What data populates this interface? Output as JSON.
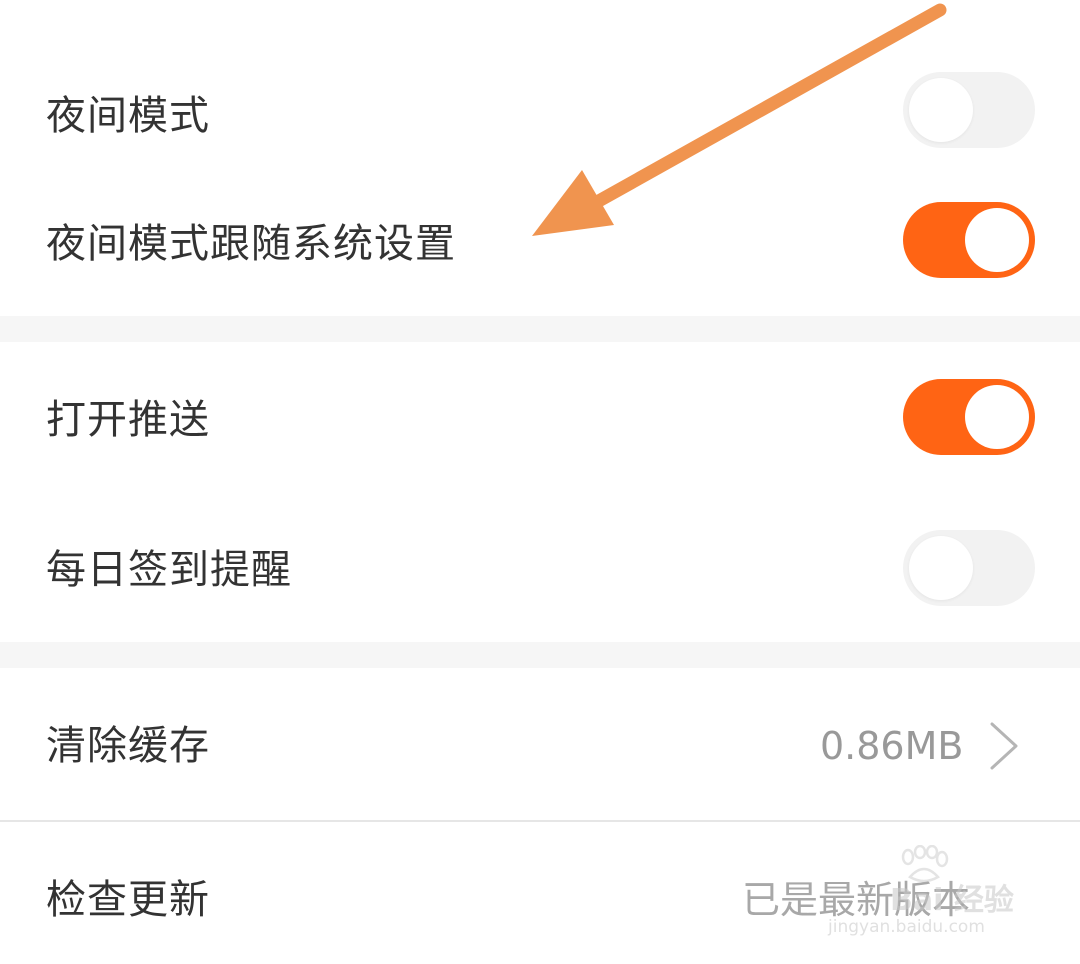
{
  "settings": {
    "night_mode": {
      "label": "夜间模式",
      "enabled": false
    },
    "night_mode_follow_system": {
      "label": "夜间模式跟随系统设置",
      "enabled": true
    },
    "push": {
      "label": "打开推送",
      "enabled": true
    },
    "checkin_reminder": {
      "label": "每日签到提醒",
      "enabled": false
    },
    "clear_cache": {
      "label": "清除缓存",
      "value": "0.86MB"
    },
    "check_update": {
      "label": "检查更新",
      "value": "已是最新版本"
    }
  },
  "watermark": {
    "brand": "Bai 经验",
    "url": "jingyan.baidu.com"
  },
  "colors": {
    "accent": "#ff6414",
    "toggle_off": "#f2f2f2",
    "annotation_arrow": "#f0944f",
    "label": "#333333",
    "secondary": "#999999",
    "gap": "#f6f6f6"
  },
  "icons": {
    "chevron": "chevron-right-icon",
    "annotation": "annotation-arrow-icon",
    "watermark": "baidu-paw-icon"
  }
}
